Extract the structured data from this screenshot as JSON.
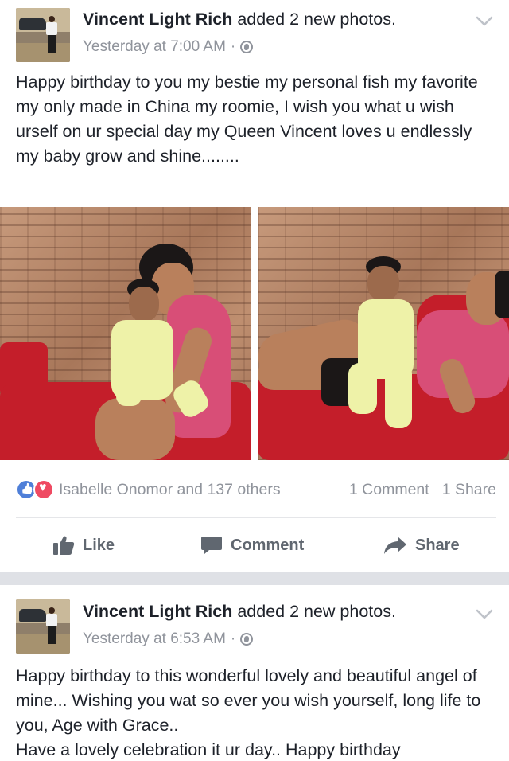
{
  "posts": [
    {
      "author": "Vincent Light Rich",
      "action": " added 2 new photos.",
      "time": "Yesterday at 7:00 AM",
      "separator": "·",
      "text": "Happy birthday to you my bestie my personal fish my favorite my only made in China my roomie, I wish you what u wish urself on ur special day my Queen Vincent loves u endlessly my baby grow and shine........",
      "reactors": "Isabelle Onomor and 137 others",
      "comments": "1 Comment",
      "shares": "1 Share",
      "actions": {
        "like": "Like",
        "comment": "Comment",
        "share": "Share"
      }
    },
    {
      "author": "Vincent Light Rich",
      "action": " added 2 new photos.",
      "time": "Yesterday at 6:53 AM",
      "separator": "·",
      "text": "Happy birthday to this wonderful lovely and beautiful angel of mine... Wishing you wat so ever you wish yourself, long life to you,  Age with Grace..\n Have a lovely celebration it ur day.. Happy birthday"
    }
  ],
  "icons": {
    "reaction_like": "like-reaction-icon",
    "reaction_love": "love-reaction-icon",
    "audience": "globe-icon",
    "menu": "chevron-down-icon"
  },
  "colors": {
    "text": "#1d2129",
    "secondary": "#90949c",
    "like_blue": "#4f7fd8",
    "love_red": "#ef4a62",
    "divider_band": "#dfe1e6"
  }
}
